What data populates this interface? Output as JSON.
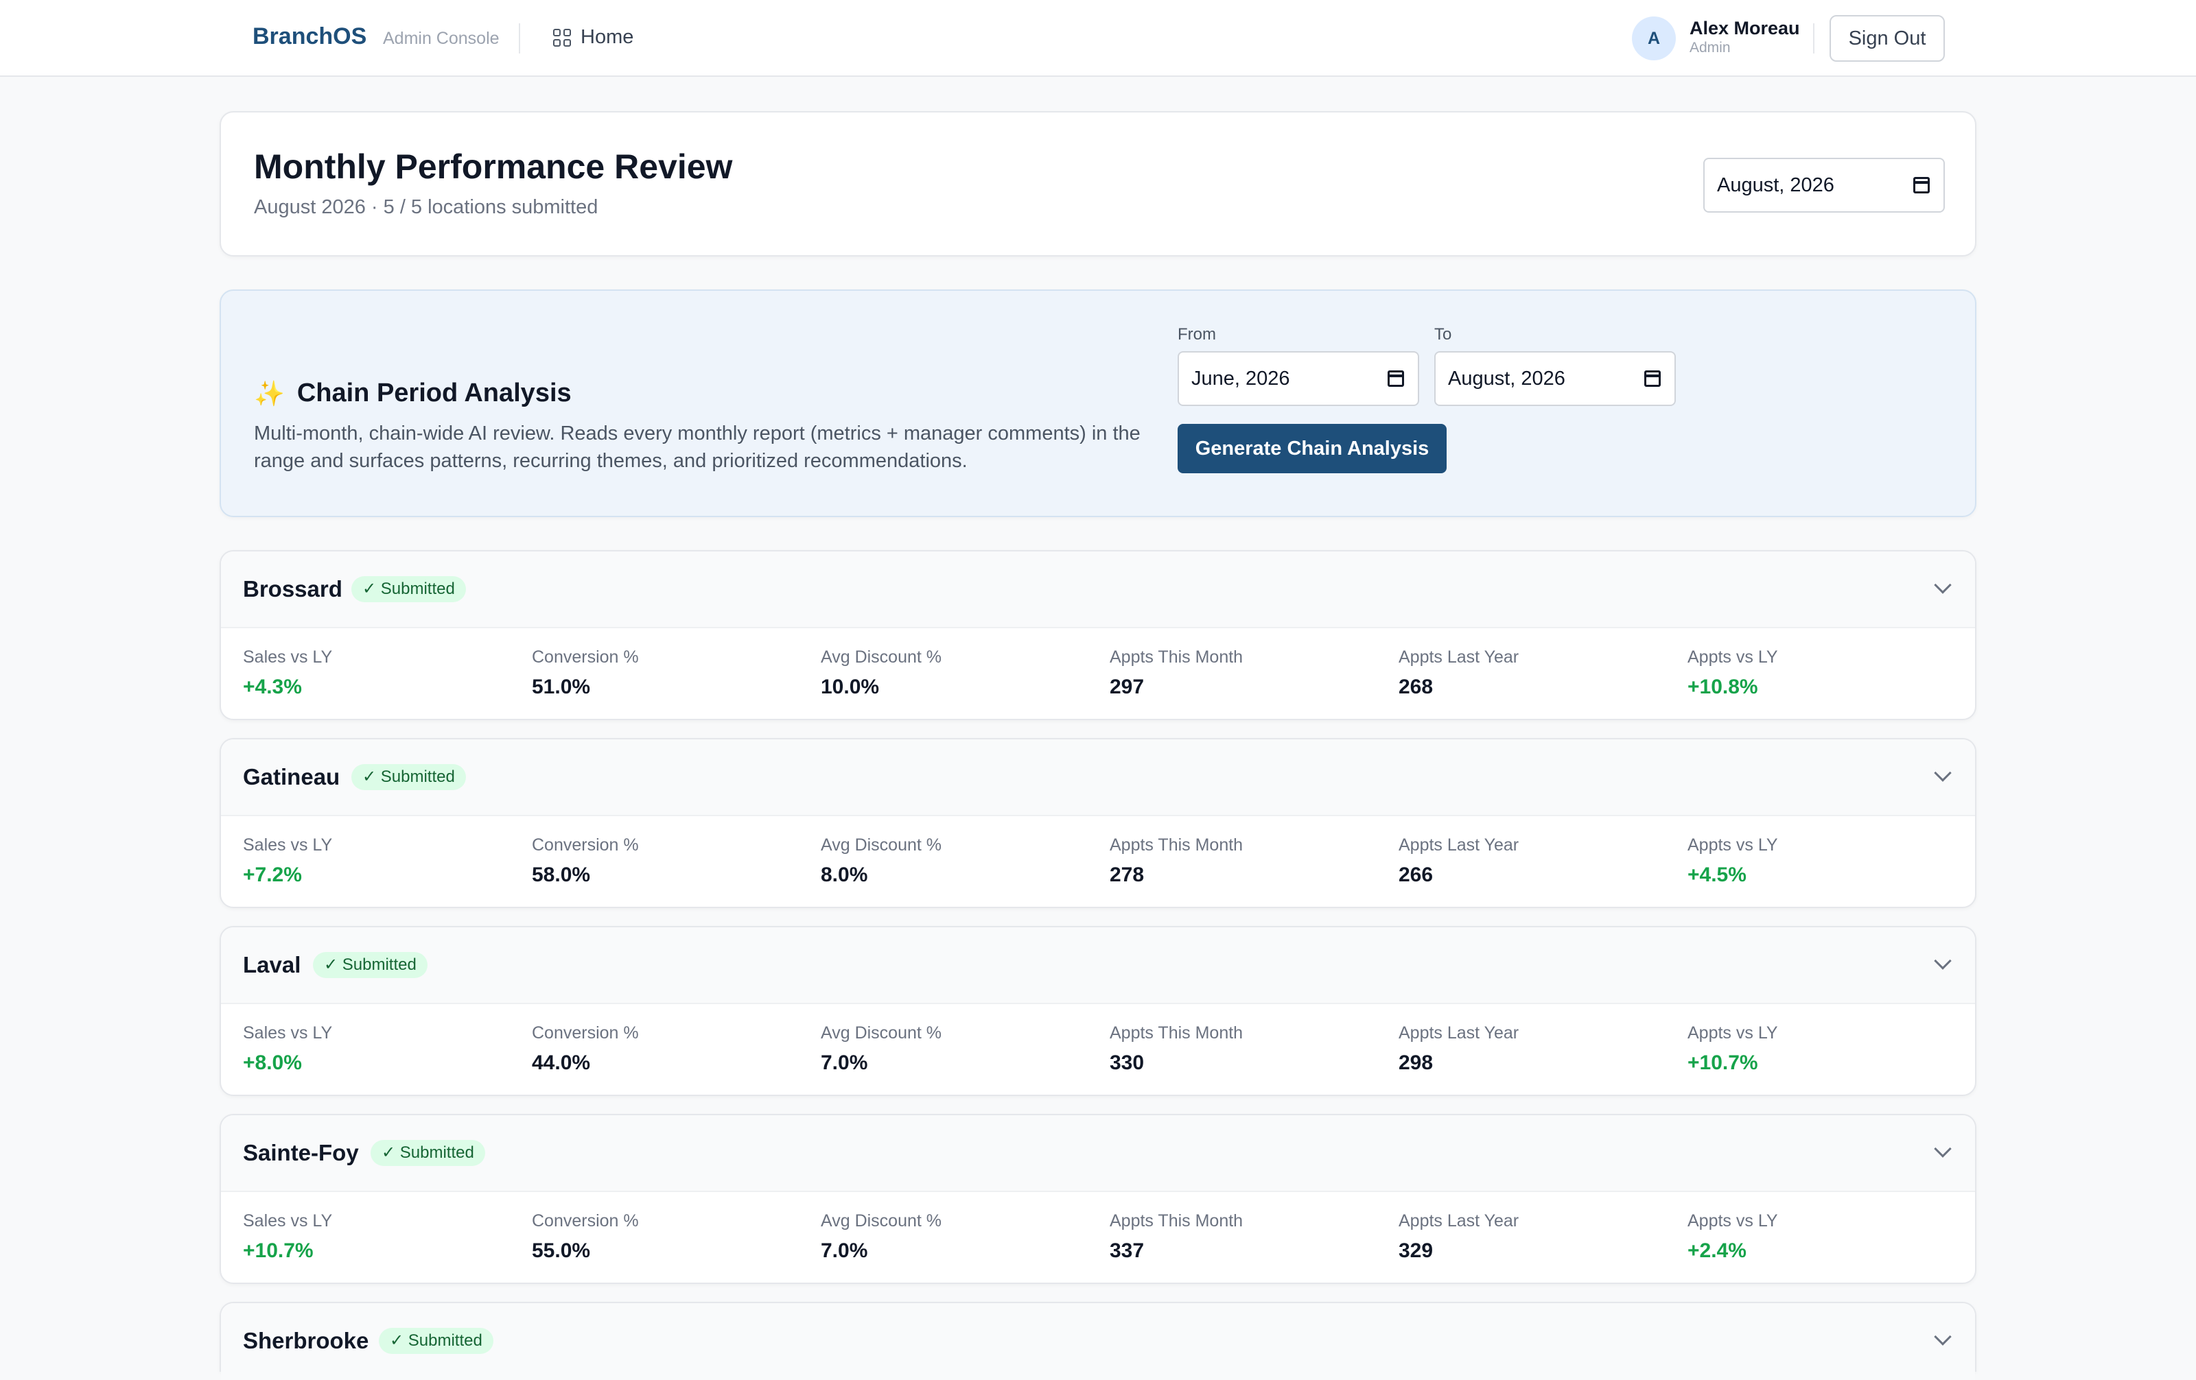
{
  "header": {
    "brand": "BranchOS",
    "brand_sub": "Admin Console",
    "home_label": "Home",
    "avatar_initial": "A",
    "user_name": "Alex Moreau",
    "user_role": "Admin",
    "signout_label": "Sign Out"
  },
  "review": {
    "title": "Monthly Performance Review",
    "subtitle": "August 2026 · 5 / 5 locations submitted",
    "month_value": "August, 2026"
  },
  "analysis": {
    "title": "Chain Period Analysis",
    "description": "Multi-month, chain-wide AI review. Reads every monthly report (metrics + manager comments) in the range and surfaces patterns, recurring themes, and prioritized recommendations.",
    "from_label": "From",
    "from_value": "June, 2026",
    "to_label": "To",
    "to_value": "August, 2026",
    "button_label": "Generate Chain Analysis"
  },
  "metric_labels": [
    "Sales vs LY",
    "Conversion %",
    "Avg Discount %",
    "Appts This Month",
    "Appts Last Year",
    "Appts vs LY"
  ],
  "locations": [
    {
      "name": "Brossard",
      "status": "✓ Submitted",
      "metrics": [
        "+4.3%",
        "51.0%",
        "10.0%",
        "297",
        "268",
        "+10.8%"
      ]
    },
    {
      "name": "Gatineau",
      "status": "✓ Submitted",
      "metrics": [
        "+7.2%",
        "58.0%",
        "8.0%",
        "278",
        "266",
        "+4.5%"
      ]
    },
    {
      "name": "Laval",
      "status": "✓ Submitted",
      "metrics": [
        "+8.0%",
        "44.0%",
        "7.0%",
        "330",
        "298",
        "+10.7%"
      ]
    },
    {
      "name": "Sainte-Foy",
      "status": "✓ Submitted",
      "metrics": [
        "+10.7%",
        "55.0%",
        "7.0%",
        "337",
        "329",
        "+2.4%"
      ]
    },
    {
      "name": "Sherbrooke",
      "status": "✓ Submitted",
      "metrics": []
    }
  ]
}
